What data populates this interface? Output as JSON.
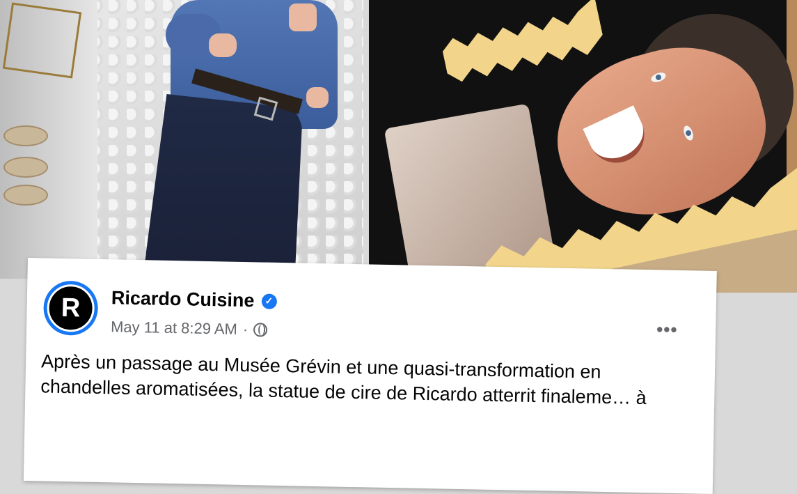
{
  "post": {
    "page_name": "Ricardo Cuisine",
    "avatar_letter": "R",
    "verified_mark": "✓",
    "date": "May 11 at 8:29 AM",
    "separator": "·",
    "privacy_icon": "globe-icon",
    "more_label": "•••",
    "text": "Après un passage au Musée Grévin et une quasi-transformation en chandelles aromatisées, la statue de cire de Ricardo atterrit finaleme…  à"
  },
  "colors": {
    "brand_blue": "#1877f2",
    "text_primary": "#050505",
    "text_secondary": "#65676b"
  }
}
